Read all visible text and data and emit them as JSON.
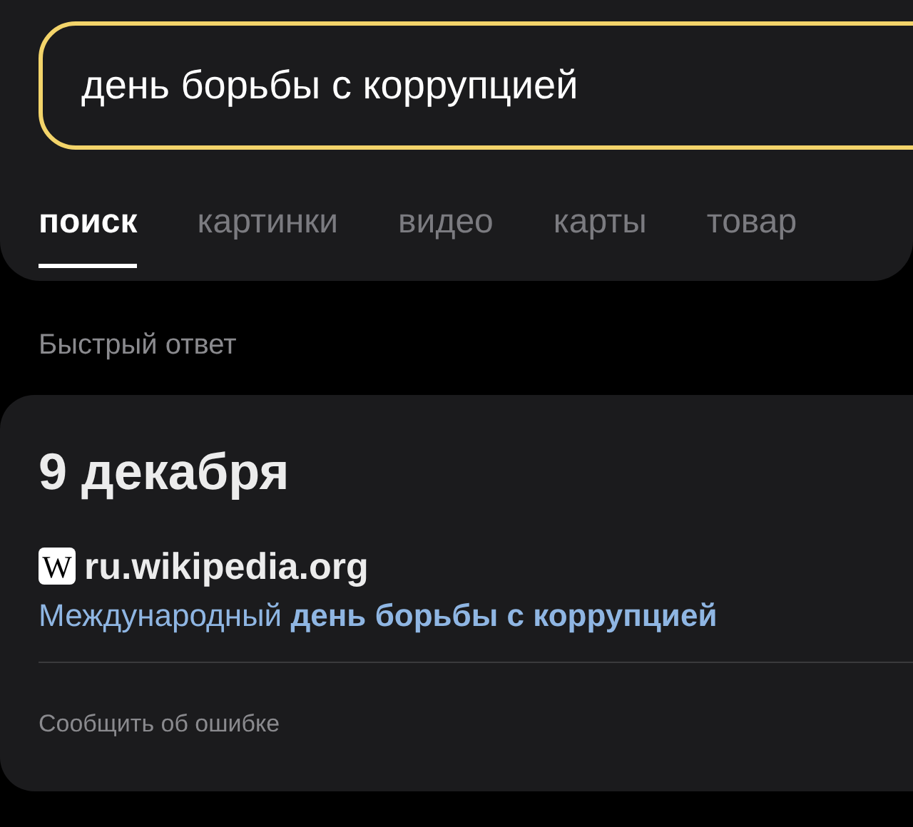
{
  "search": {
    "value": "день борьбы с коррупцией"
  },
  "tabs": [
    {
      "label": "поиск",
      "selected": true
    },
    {
      "label": "картинки",
      "selected": false
    },
    {
      "label": "видео",
      "selected": false
    },
    {
      "label": "карты",
      "selected": false
    },
    {
      "label": "товар",
      "selected": false
    }
  ],
  "section_label": "Быстрый ответ",
  "answer": {
    "title": "9 декабря",
    "source_icon": "W",
    "source": "ru.wikipedia.org",
    "link": "Международный **день борьбы с коррупцией**",
    "report": "Сообщить об ошибке"
  }
}
